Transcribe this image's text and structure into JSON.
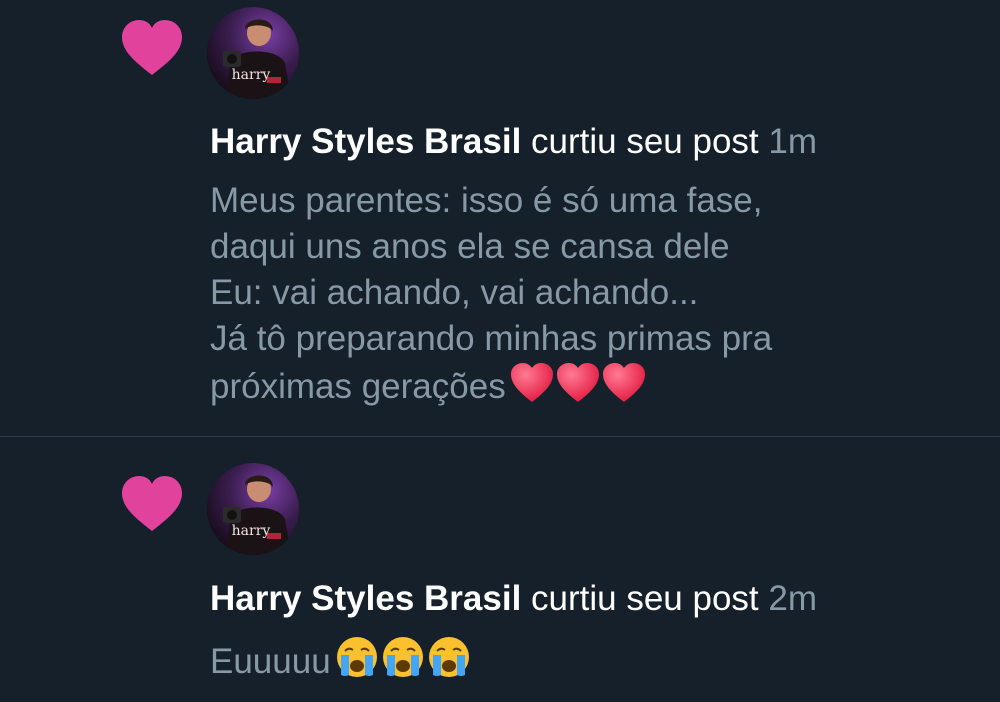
{
  "notifications": [
    {
      "icon": "heart-icon",
      "avatar_label": "harry",
      "user_name": "Harry Styles Brasil",
      "action": "curtiu seu post",
      "time": "1m",
      "post_text": "Meus parentes: isso é só uma fase,\ndaqui uns anos ela se cansa dele\nEu: vai achando, vai achando...\nJá tô preparando minhas primas pra\npróximas gerações",
      "trailing_emoji": [
        "red-heart-emoji",
        "red-heart-emoji",
        "red-heart-emoji"
      ]
    },
    {
      "icon": "heart-icon",
      "avatar_label": "harry",
      "user_name": "Harry Styles Brasil",
      "action": "curtiu seu post",
      "time": "2m",
      "post_text": "Euuuuu",
      "trailing_emoji": [
        "crying-face-emoji",
        "crying-face-emoji",
        "crying-face-emoji"
      ]
    }
  ],
  "colors": {
    "background": "#15202b",
    "heart": "#e0429c",
    "name": "#ffffff",
    "secondary": "#8899a6",
    "divider": "#263a4d"
  }
}
